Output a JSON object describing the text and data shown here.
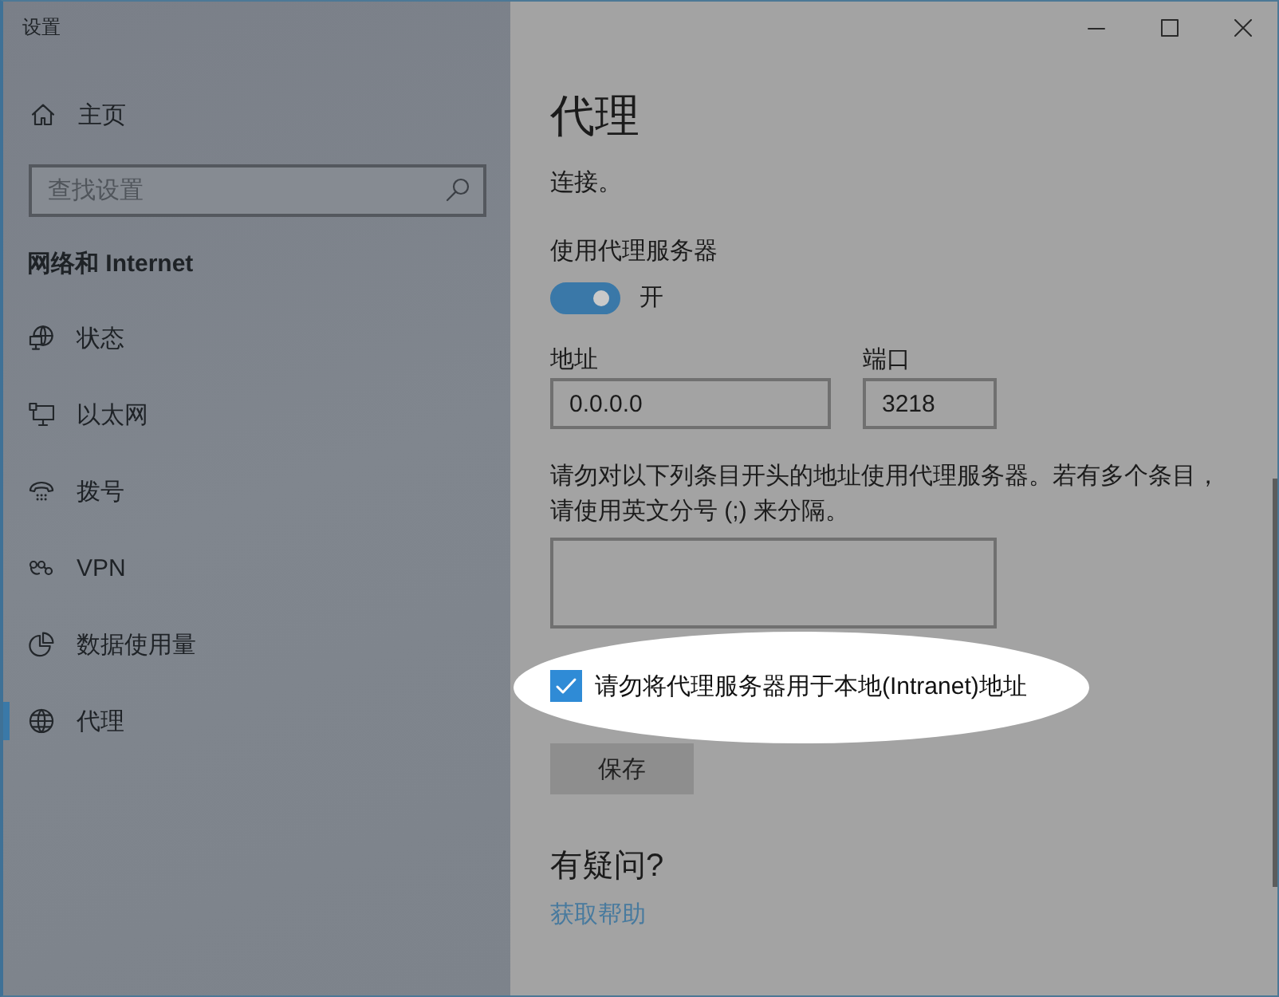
{
  "window": {
    "title": "设置"
  },
  "sidebar": {
    "home": "主页",
    "search": {
      "placeholder": "查找设置"
    },
    "section": "网络和 Internet",
    "items": [
      {
        "kind": "status",
        "label": "状态",
        "selected": false
      },
      {
        "kind": "ethernet",
        "label": "以太网",
        "selected": false
      },
      {
        "kind": "dialup",
        "label": "拨号",
        "selected": false
      },
      {
        "kind": "vpn",
        "label": "VPN",
        "selected": false
      },
      {
        "kind": "data",
        "label": "数据使用量",
        "selected": false
      },
      {
        "kind": "proxy",
        "label": "代理",
        "selected": true
      }
    ]
  },
  "page": {
    "title": "代理",
    "intro_tail": "连接。",
    "use_proxy": {
      "label": "使用代理服务器",
      "on": true,
      "state_label": "开"
    },
    "address": {
      "label": "地址",
      "value": "0.0.0.0"
    },
    "port": {
      "label": "端口",
      "value": "3218"
    },
    "exceptions": {
      "description": "请勿对以下列条目开头的地址使用代理服务器。若有多个条目，请使用英文分号 (;) 来分隔。"
    },
    "bypass_local": {
      "label": "请勿将代理服务器用于本地(Intranet)地址",
      "checked": true,
      "highlighted": true
    },
    "save_button": "保存",
    "help": {
      "heading": "有疑问?",
      "link": "获取帮助"
    }
  }
}
